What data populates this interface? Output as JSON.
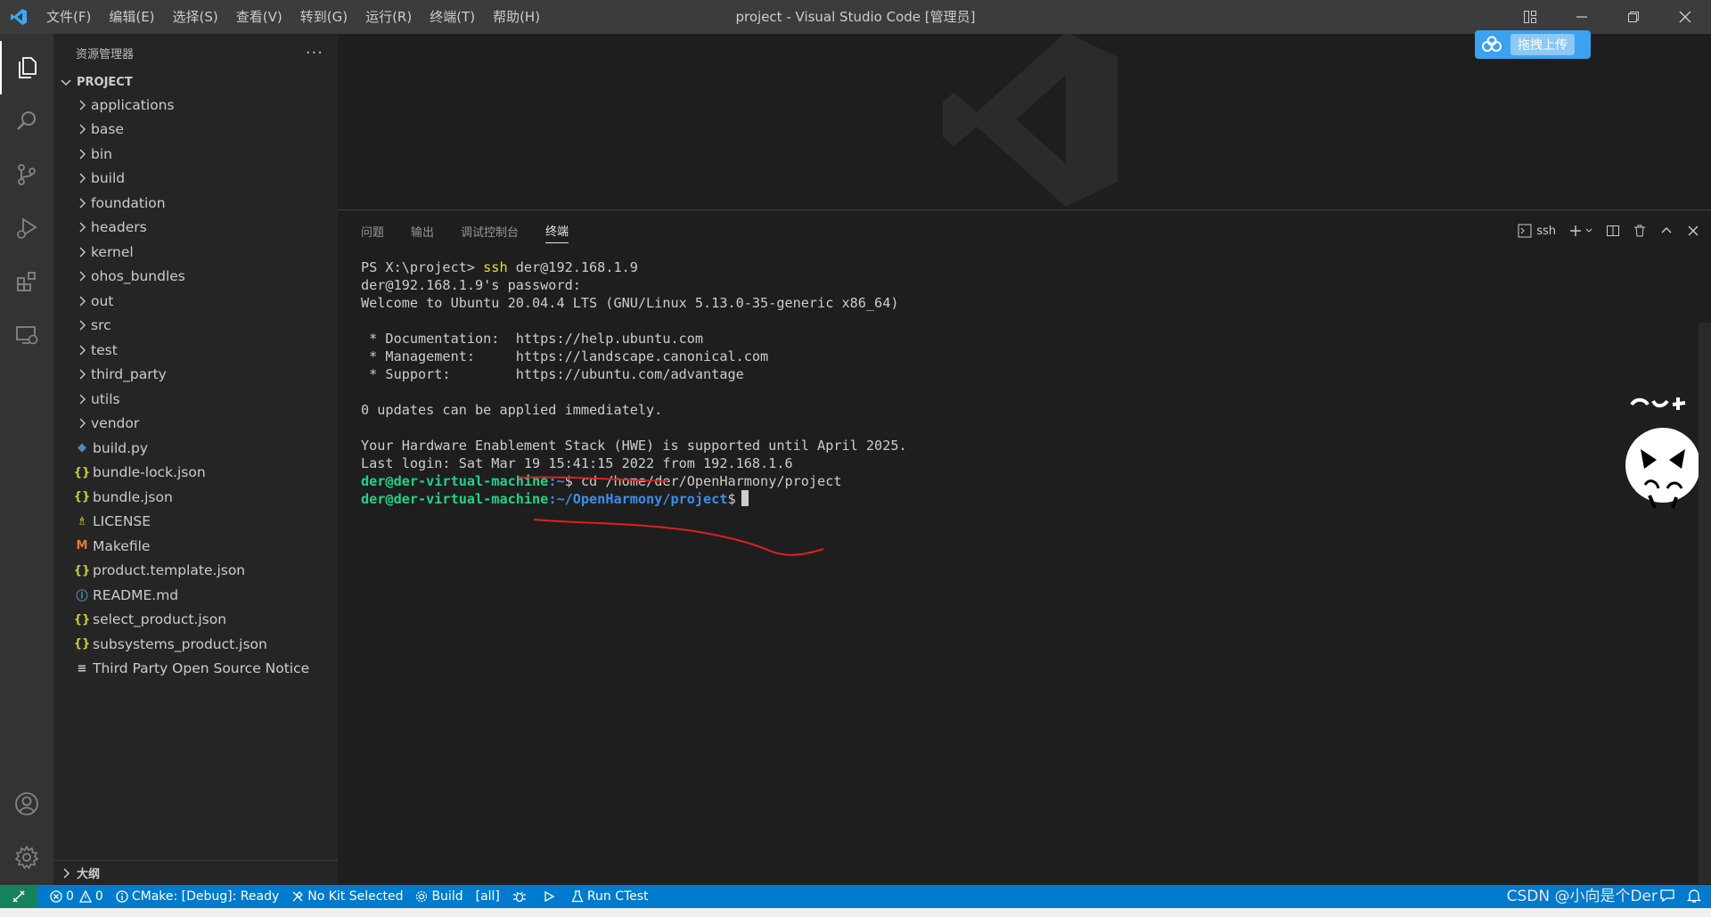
{
  "titlebar": {
    "menu": [
      "文件(F)",
      "编辑(E)",
      "选择(S)",
      "查看(V)",
      "转到(G)",
      "运行(R)",
      "终端(T)",
      "帮助(H)"
    ],
    "title": "project - Visual Studio Code [管理员]"
  },
  "sidebar": {
    "header": "资源管理器",
    "section": "PROJECT",
    "folders": [
      "applications",
      "base",
      "bin",
      "build",
      "foundation",
      "headers",
      "kernel",
      "ohos_bundles",
      "out",
      "src",
      "test",
      "third_party",
      "utils",
      "vendor"
    ],
    "files": [
      {
        "name": "build.py",
        "icon": "python-file-icon",
        "glyph": "◆",
        "color": "#4b8bbe"
      },
      {
        "name": "bundle-lock.json",
        "icon": "json-file-icon",
        "glyph": "{}",
        "color": "#cbcb41"
      },
      {
        "name": "bundle.json",
        "icon": "json-file-icon",
        "glyph": "{}",
        "color": "#cbcb41"
      },
      {
        "name": "LICENSE",
        "icon": "license-file-icon",
        "glyph": "♗",
        "color": "#cbcb41"
      },
      {
        "name": "Makefile",
        "icon": "makefile-icon",
        "glyph": "M",
        "color": "#e37933"
      },
      {
        "name": "product.template.json",
        "icon": "json-file-icon",
        "glyph": "{}",
        "color": "#cbcb41"
      },
      {
        "name": "README.md",
        "icon": "info-file-icon",
        "glyph": "ⓘ",
        "color": "#519aba"
      },
      {
        "name": "select_product.json",
        "icon": "json-file-icon",
        "glyph": "{}",
        "color": "#cbcb41"
      },
      {
        "name": "subsystems_product.json",
        "icon": "json-file-icon",
        "glyph": "{}",
        "color": "#cbcb41"
      },
      {
        "name": "Third Party Open Source Notice",
        "icon": "text-file-icon",
        "glyph": "≡",
        "color": "#cccccc"
      }
    ],
    "outline": "大纲"
  },
  "upload_button": {
    "label": "拖拽上传"
  },
  "panel": {
    "tabs": [
      "问题",
      "输出",
      "调试控制台",
      "终端"
    ],
    "active_tab": "终端",
    "terminal_name": "ssh"
  },
  "terminal": {
    "l1_prompt": "PS X:\\project> ",
    "l1_cmd": "ssh",
    "l1_arg": " der@192.168.1.9",
    "l2": "der@192.168.1.9's password:",
    "l3": "Welcome to Ubuntu 20.04.4 LTS (GNU/Linux 5.13.0-35-generic x86_64)",
    "l5": " * Documentation:  https://help.ubuntu.com",
    "l6": " * Management:     https://landscape.canonical.com",
    "l7": " * Support:        https://ubuntu.com/advantage",
    "l9": "0 updates can be applied immediately.",
    "l11": "Your Hardware Enablement Stack (HWE) is supported until April 2025.",
    "l12": "Last login: Sat Mar 19 15:41:15 2022 from 192.168.1.6",
    "l13_user": "der@der-virtual-machine",
    "l13_path": ":~",
    "l13_cmd": "$ cd /home/der/OpenHarmony/project",
    "l14_user": "der@der-virtual-machine",
    "l14_path": ":~/OpenHarmony/project",
    "l14_cmd": "$"
  },
  "statusbar": {
    "errors": "0",
    "warnings": "0",
    "cmake": "CMake: [Debug]: Ready",
    "kit": "No Kit Selected",
    "build": "Build",
    "target": "[all]",
    "ctest": "Run CTest",
    "watermark": "CSDN @小向是个Der"
  },
  "colors": {
    "accent": "#007acc",
    "remote": "#16825d",
    "prompt_green": "#23d18b",
    "prompt_blue": "#3b8eea",
    "annotation_red": "#e02020"
  }
}
